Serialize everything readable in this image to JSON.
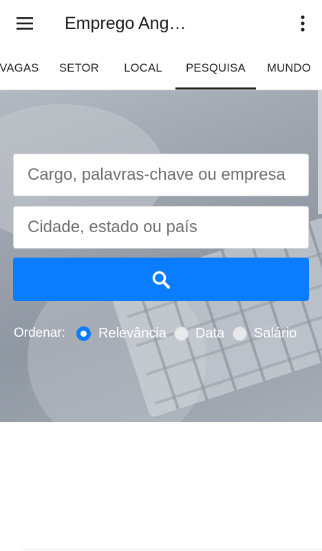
{
  "app": {
    "title": "Emprego Ang…",
    "menu_icon": "hamburger-menu-icon",
    "overflow_icon": "more-vertical-icon"
  },
  "tabs": [
    {
      "label": "VAGAS",
      "active": false
    },
    {
      "label": "SETOR",
      "active": false
    },
    {
      "label": "LOCAL",
      "active": false
    },
    {
      "label": "PESQUISA",
      "active": true
    },
    {
      "label": "MUNDO",
      "active": false
    }
  ],
  "search": {
    "keywords_placeholder": "Cargo, palavras-chave ou empresa",
    "location_placeholder": "Cidade, estado ou país",
    "button_icon": "search-icon",
    "button_color": "#0a7cff"
  },
  "sort": {
    "label": "Ordenar:",
    "options": [
      {
        "label": "Relevância",
        "selected": true
      },
      {
        "label": "Data",
        "selected": false
      },
      {
        "label": "Salário",
        "selected": false
      }
    ]
  }
}
